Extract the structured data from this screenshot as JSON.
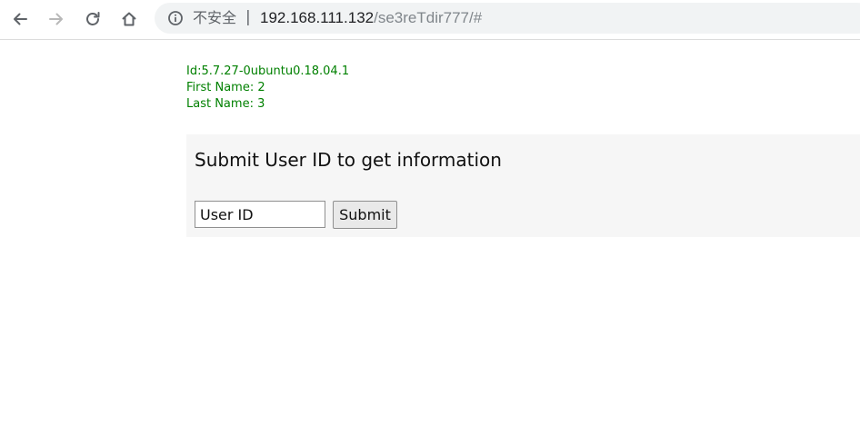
{
  "browser": {
    "security_label": "不安全",
    "separator": "|",
    "url_host": "192.168.111.132",
    "url_path": "/se3reTdir777/#",
    "icons": [
      "back-arrow-icon",
      "forward-arrow-icon",
      "reload-icon",
      "home-icon",
      "info-icon"
    ]
  },
  "result": {
    "id_line": "Id:5.7.27-0ubuntu0.18.04.1",
    "first_name_line": "First Name: 2",
    "last_name_line": "Last Name: 3",
    "color": "#008000"
  },
  "form": {
    "heading": "Submit User ID to get information",
    "input_value": "User ID",
    "submit_label": "Submit"
  }
}
